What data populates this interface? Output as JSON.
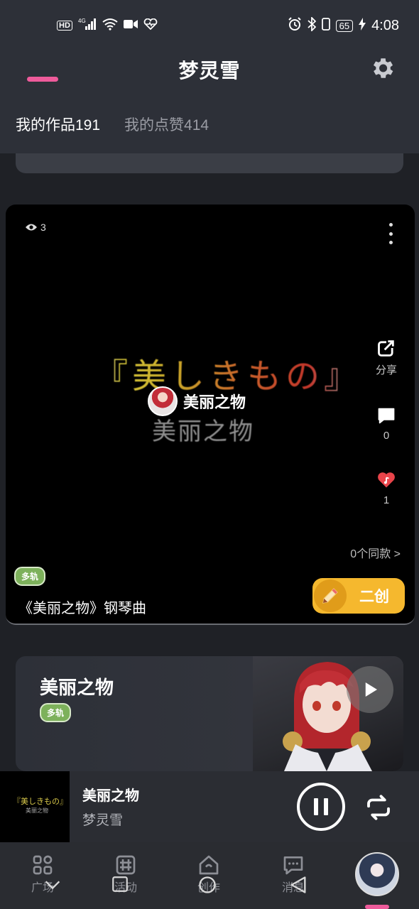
{
  "status_bar": {
    "network_badge": "HD",
    "network_type": "4G",
    "battery_level": "65",
    "time": "4:08",
    "icons_left": [
      "hd-icon",
      "signal-icon",
      "wifi-icon",
      "video-icon",
      "heart-monitor-icon"
    ],
    "icons_right": [
      "alarm-icon",
      "bluetooth-icon",
      "vibrate-icon",
      "battery-icon",
      "charging-icon"
    ]
  },
  "header": {
    "title": "梦灵雪",
    "tabs": [
      {
        "label": "我的作品191",
        "active": true
      },
      {
        "label": "我的点赞414",
        "active": false
      }
    ]
  },
  "video_card": {
    "view_count": "3",
    "artwork_text_jp": "『美しきもの』",
    "artwork_text_cn": "美丽之物",
    "author_name": "美丽之物",
    "share_label": "分享",
    "comment_count": "0",
    "like_count": "1",
    "same_style_label": "0个同款 >",
    "tag": "多轨",
    "song_title": "《美丽之物》钢琴曲",
    "remix_label": "二创"
  },
  "track_card": {
    "title": "美丽之物",
    "tag": "多轨"
  },
  "mini_player": {
    "cover_text_jp": "『美しきもの』",
    "cover_text_cn": "美丽之物",
    "title": "美丽之物",
    "artist": "梦灵雪"
  },
  "bottom_nav": {
    "items": [
      {
        "label": "广场",
        "icon": "grid-icon"
      },
      {
        "label": "活动",
        "icon": "hash-icon"
      },
      {
        "label": "创作",
        "icon": "house-icon"
      },
      {
        "label": "消息",
        "icon": "chat-icon"
      }
    ]
  },
  "colors": {
    "accent_pink": "#ee5b9b",
    "remix_yellow": "#f5b82e",
    "tag_green": "#7db15b",
    "like_red": "#e8444a"
  }
}
